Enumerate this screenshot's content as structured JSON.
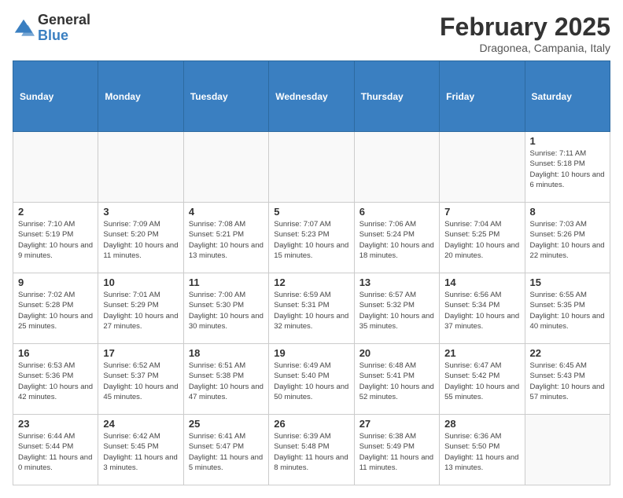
{
  "logo": {
    "general": "General",
    "blue": "Blue"
  },
  "header": {
    "month": "February 2025",
    "location": "Dragonea, Campania, Italy"
  },
  "days_of_week": [
    "Sunday",
    "Monday",
    "Tuesday",
    "Wednesday",
    "Thursday",
    "Friday",
    "Saturday"
  ],
  "weeks": [
    [
      {
        "day": "",
        "info": ""
      },
      {
        "day": "",
        "info": ""
      },
      {
        "day": "",
        "info": ""
      },
      {
        "day": "",
        "info": ""
      },
      {
        "day": "",
        "info": ""
      },
      {
        "day": "",
        "info": ""
      },
      {
        "day": "1",
        "info": "Sunrise: 7:11 AM\nSunset: 5:18 PM\nDaylight: 10 hours and 6 minutes."
      }
    ],
    [
      {
        "day": "2",
        "info": "Sunrise: 7:10 AM\nSunset: 5:19 PM\nDaylight: 10 hours and 9 minutes."
      },
      {
        "day": "3",
        "info": "Sunrise: 7:09 AM\nSunset: 5:20 PM\nDaylight: 10 hours and 11 minutes."
      },
      {
        "day": "4",
        "info": "Sunrise: 7:08 AM\nSunset: 5:21 PM\nDaylight: 10 hours and 13 minutes."
      },
      {
        "day": "5",
        "info": "Sunrise: 7:07 AM\nSunset: 5:23 PM\nDaylight: 10 hours and 15 minutes."
      },
      {
        "day": "6",
        "info": "Sunrise: 7:06 AM\nSunset: 5:24 PM\nDaylight: 10 hours and 18 minutes."
      },
      {
        "day": "7",
        "info": "Sunrise: 7:04 AM\nSunset: 5:25 PM\nDaylight: 10 hours and 20 minutes."
      },
      {
        "day": "8",
        "info": "Sunrise: 7:03 AM\nSunset: 5:26 PM\nDaylight: 10 hours and 22 minutes."
      }
    ],
    [
      {
        "day": "9",
        "info": "Sunrise: 7:02 AM\nSunset: 5:28 PM\nDaylight: 10 hours and 25 minutes."
      },
      {
        "day": "10",
        "info": "Sunrise: 7:01 AM\nSunset: 5:29 PM\nDaylight: 10 hours and 27 minutes."
      },
      {
        "day": "11",
        "info": "Sunrise: 7:00 AM\nSunset: 5:30 PM\nDaylight: 10 hours and 30 minutes."
      },
      {
        "day": "12",
        "info": "Sunrise: 6:59 AM\nSunset: 5:31 PM\nDaylight: 10 hours and 32 minutes."
      },
      {
        "day": "13",
        "info": "Sunrise: 6:57 AM\nSunset: 5:32 PM\nDaylight: 10 hours and 35 minutes."
      },
      {
        "day": "14",
        "info": "Sunrise: 6:56 AM\nSunset: 5:34 PM\nDaylight: 10 hours and 37 minutes."
      },
      {
        "day": "15",
        "info": "Sunrise: 6:55 AM\nSunset: 5:35 PM\nDaylight: 10 hours and 40 minutes."
      }
    ],
    [
      {
        "day": "16",
        "info": "Sunrise: 6:53 AM\nSunset: 5:36 PM\nDaylight: 10 hours and 42 minutes."
      },
      {
        "day": "17",
        "info": "Sunrise: 6:52 AM\nSunset: 5:37 PM\nDaylight: 10 hours and 45 minutes."
      },
      {
        "day": "18",
        "info": "Sunrise: 6:51 AM\nSunset: 5:38 PM\nDaylight: 10 hours and 47 minutes."
      },
      {
        "day": "19",
        "info": "Sunrise: 6:49 AM\nSunset: 5:40 PM\nDaylight: 10 hours and 50 minutes."
      },
      {
        "day": "20",
        "info": "Sunrise: 6:48 AM\nSunset: 5:41 PM\nDaylight: 10 hours and 52 minutes."
      },
      {
        "day": "21",
        "info": "Sunrise: 6:47 AM\nSunset: 5:42 PM\nDaylight: 10 hours and 55 minutes."
      },
      {
        "day": "22",
        "info": "Sunrise: 6:45 AM\nSunset: 5:43 PM\nDaylight: 10 hours and 57 minutes."
      }
    ],
    [
      {
        "day": "23",
        "info": "Sunrise: 6:44 AM\nSunset: 5:44 PM\nDaylight: 11 hours and 0 minutes."
      },
      {
        "day": "24",
        "info": "Sunrise: 6:42 AM\nSunset: 5:45 PM\nDaylight: 11 hours and 3 minutes."
      },
      {
        "day": "25",
        "info": "Sunrise: 6:41 AM\nSunset: 5:47 PM\nDaylight: 11 hours and 5 minutes."
      },
      {
        "day": "26",
        "info": "Sunrise: 6:39 AM\nSunset: 5:48 PM\nDaylight: 11 hours and 8 minutes."
      },
      {
        "day": "27",
        "info": "Sunrise: 6:38 AM\nSunset: 5:49 PM\nDaylight: 11 hours and 11 minutes."
      },
      {
        "day": "28",
        "info": "Sunrise: 6:36 AM\nSunset: 5:50 PM\nDaylight: 11 hours and 13 minutes."
      },
      {
        "day": "",
        "info": ""
      }
    ]
  ]
}
